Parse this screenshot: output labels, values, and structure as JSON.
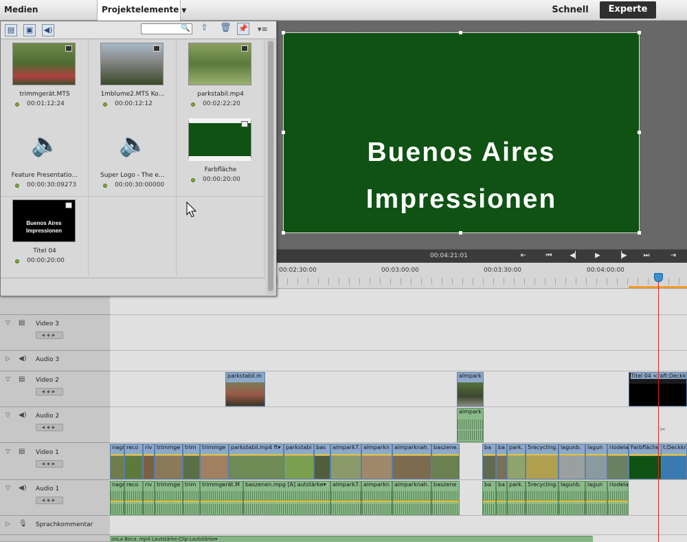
{
  "topbar": {
    "add_media_label": "Medien hinzufügen",
    "project_assets_label": "Projektelemente",
    "quick_label": "Schnell",
    "expert_label": "Experte"
  },
  "monitor": {
    "title_line1": "Buenos Aires",
    "title_line2": "Impressionen",
    "title_bg_color": "#0f5214",
    "timecode": "00:04:21:01"
  },
  "ruler": {
    "labels": [
      "00:02:30:00",
      "00:03:00:00",
      "00:03:30:00",
      "00:04:00:00"
    ]
  },
  "project": {
    "items": [
      {
        "name": "trimmgerät.MTS",
        "duration": "00:01:12:24",
        "type": "video"
      },
      {
        "name": "1mblume2.MTS Ko…",
        "duration": "00:00:12:12",
        "type": "video"
      },
      {
        "name": "parkstabil.mp4",
        "duration": "00:02:22:20",
        "type": "video"
      },
      {
        "name": "Feature Presentatio…",
        "duration": "00:00:30:09273",
        "type": "audio"
      },
      {
        "name": "Super Logo - The e…",
        "duration": "00:00:30:00000",
        "type": "audio"
      },
      {
        "name": "Farbfläche",
        "duration": "00:00:20:00",
        "type": "color"
      },
      {
        "name": "Titel 04",
        "duration": "00:00:20:00",
        "type": "title"
      }
    ],
    "title_thumb_line1": "Buenos Aires",
    "title_thumb_line2": "Impressionen"
  },
  "tracks": {
    "video3": "Video 3",
    "audio3": "Audio 3",
    "video2": "Video 2",
    "audio2": "Audio 2",
    "video1": "Video 1",
    "audio1": "Audio 1",
    "narration": "Sprachkommentar"
  },
  "clips": {
    "v2": [
      "parkstabil.m",
      "almpark",
      "Titel 04  <raft:Deckkra"
    ],
    "a2": [
      "almpark"
    ],
    "v1": [
      "nagr",
      "reco",
      "riv",
      "trimmge",
      "trim",
      "trimmge",
      "parkstabil.mp4  ft▾",
      "parkstabi",
      "bas",
      "almpark7.",
      "almparkn",
      "almparknah.",
      "baszene.",
      "ba",
      "ba",
      "park.",
      "5recycling.",
      "lagunb.",
      "lagun",
      "riodela",
      "Farbfläche",
      "t:Deckkra"
    ],
    "a1": [
      "nagr",
      "reco",
      "riv",
      "trimmge",
      "trim",
      "trimmgerät.M",
      "baszenen.mpg [A] autstärke▾",
      "almpark7.",
      "almparkn",
      "almparknah.",
      "baszene",
      "ba",
      "ba",
      "park.",
      "5recycling.",
      "lagunb.",
      "lagun",
      "riodela"
    ],
    "bottom": "onLa Boca. mp4 Lautstärke:Clip-Lautstärke▾"
  }
}
